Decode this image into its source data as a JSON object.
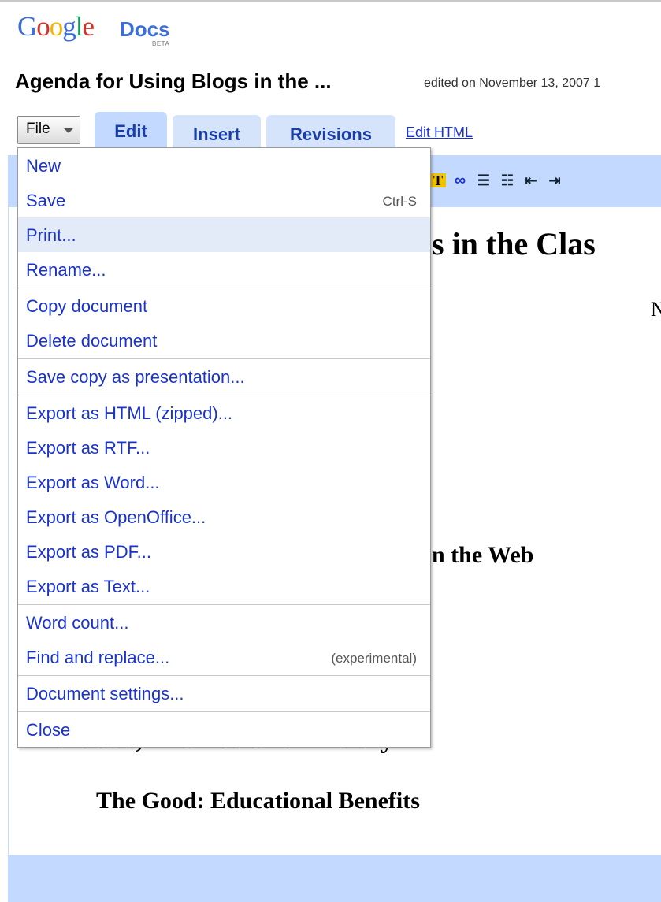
{
  "logo": {
    "google": "Google",
    "docs": "Docs",
    "beta": "BETA",
    "google_colors": [
      "#3b6ed8",
      "#d93025",
      "#f4b400",
      "#3b6ed8",
      "#0f9d58",
      "#d93025"
    ]
  },
  "document": {
    "title": "Agenda for Using Blogs in the ...",
    "edited": "edited on November 13, 2007 1"
  },
  "tabs": {
    "file": "File",
    "edit": "Edit",
    "insert": "Insert",
    "revisions": "Revisions",
    "edit_html": "Edit HTML"
  },
  "toolbar": {
    "icons": [
      "text-color-icon",
      "link-icon",
      "numbered-list-icon",
      "bulleted-list-icon",
      "outdent-icon",
      "indent-icon"
    ]
  },
  "content": {
    "heading_fragment": "s in the Clas",
    "right_char": "N",
    "web_fragment": "n the Web",
    "ugly_fragment": "Uly",
    "good_heading": "The Good: Educational Benefits"
  },
  "file_menu": {
    "items": [
      {
        "label": "New",
        "shortcut": ""
      },
      {
        "label": "Save",
        "shortcut": "Ctrl-S"
      },
      {
        "label": "Print...",
        "shortcut": ""
      },
      {
        "label": "Rename...",
        "shortcut": ""
      },
      {
        "label": "Copy document",
        "shortcut": ""
      },
      {
        "label": "Delete document",
        "shortcut": ""
      },
      {
        "label": "Save copy as presentation...",
        "shortcut": ""
      },
      {
        "label": "Export as HTML (zipped)...",
        "shortcut": ""
      },
      {
        "label": "Export as RTF...",
        "shortcut": ""
      },
      {
        "label": "Export as Word...",
        "shortcut": ""
      },
      {
        "label": "Export as OpenOffice...",
        "shortcut": ""
      },
      {
        "label": "Export as PDF...",
        "shortcut": ""
      },
      {
        "label": "Export as Text...",
        "shortcut": ""
      },
      {
        "label": "Word count...",
        "shortcut": ""
      },
      {
        "label": "Find and replace...",
        "shortcut": "(experimental)"
      },
      {
        "label": "Document settings...",
        "shortcut": ""
      },
      {
        "label": "Close",
        "shortcut": ""
      }
    ],
    "hovered_item": "Print..."
  },
  "colors": {
    "accent": "#c3d9ff",
    "link": "#1a33c8",
    "hover": "#e3ebf8"
  }
}
